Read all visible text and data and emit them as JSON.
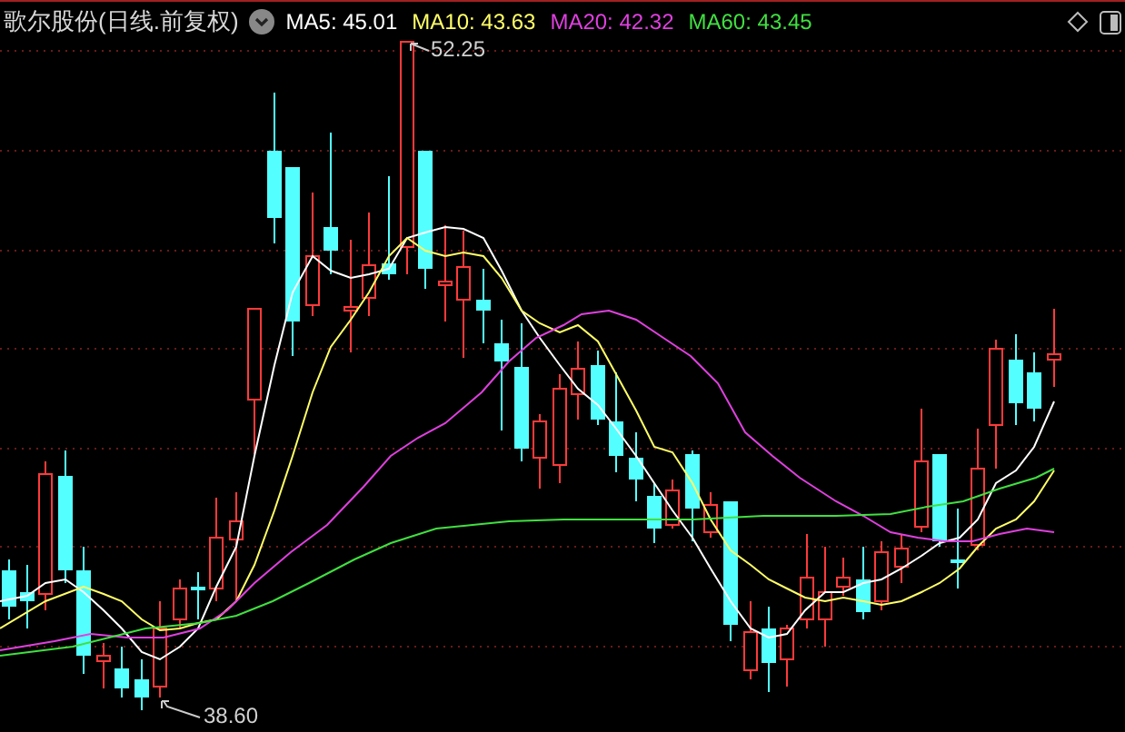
{
  "header": {
    "title": "歌尔股份(日线.前复权)",
    "indicators": [
      {
        "label": "MA5: 45.01",
        "color": "#ffffff"
      },
      {
        "label": "MA10: 43.63",
        "color": "#ffff66"
      },
      {
        "label": "MA20: 42.32",
        "color": "#e040e0"
      },
      {
        "label": "MA60: 43.45",
        "color": "#40e040"
      }
    ]
  },
  "chart": {
    "annotations": [
      {
        "kind": "high",
        "text": "52.25"
      },
      {
        "kind": "low",
        "text": "38.60"
      }
    ]
  }
}
